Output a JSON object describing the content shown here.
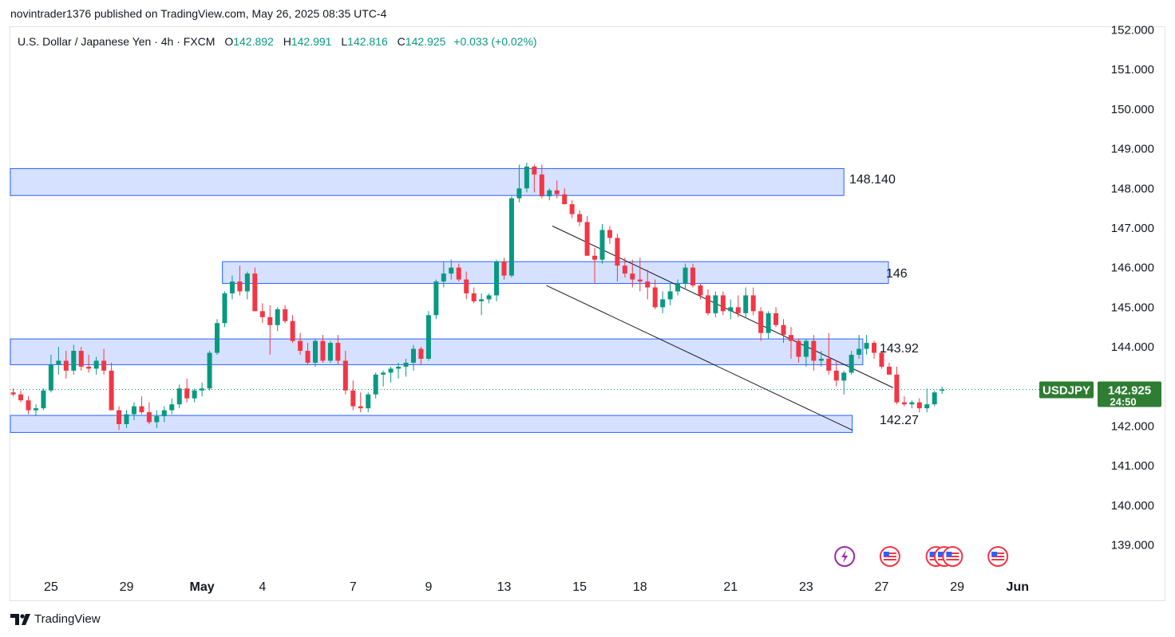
{
  "header": {
    "publisher_line": "novintrader1376 published on TradingView.com, May 26, 2025 08:35 UTC-4"
  },
  "legend": {
    "symbol_line": "U.S. Dollar / Japanese Yen · 4h · FXCM",
    "open_label": "O",
    "open": "142.892",
    "high_label": "H",
    "high": "142.991",
    "low_label": "L",
    "low": "142.816",
    "close_label": "C",
    "close": "142.925",
    "change": "+0.033 (+0.02%)"
  },
  "footer": {
    "brand": "TradingView"
  },
  "colors": {
    "up": "#089981",
    "down": "#f23645",
    "zone_fill": "#d6e1ff",
    "zone_stroke": "#2962ff",
    "price_tag": "#2e7d32",
    "event_purple": "#9c27b0",
    "event_red": "#f23645"
  },
  "icons": [
    "lightning-event-icon",
    "us-flag-event-icon"
  ],
  "price_tag": {
    "symbol": "USDJPY",
    "price": "142.925",
    "countdown": "24:50"
  },
  "chart_data": {
    "type": "candlestick",
    "symbol": "USDJPY",
    "timeframe": "4h",
    "y_axis": {
      "ylim": [
        138.7,
        152.05
      ],
      "ticks": [
        "152.000",
        "151.000",
        "150.000",
        "149.000",
        "148.000",
        "147.000",
        "146.000",
        "145.000",
        "144.000",
        "143.000",
        "142.000",
        "141.000",
        "140.000",
        "139.000"
      ]
    },
    "x_axis": {
      "ticks": [
        {
          "label": "25",
          "i": 5
        },
        {
          "label": "29",
          "i": 15
        },
        {
          "label": "May",
          "i": 25
        },
        {
          "label": "4",
          "i": 33
        },
        {
          "label": "7",
          "i": 45
        },
        {
          "label": "9",
          "i": 55
        },
        {
          "label": "13",
          "i": 65
        },
        {
          "label": "15",
          "i": 75
        },
        {
          "label": "18",
          "i": 83
        },
        {
          "label": "21",
          "i": 95
        },
        {
          "label": "23",
          "i": 105
        },
        {
          "label": "27",
          "i": 115
        },
        {
          "label": "29",
          "i": 125
        },
        {
          "label": "Jun",
          "i": 133
        }
      ]
    },
    "zones": [
      {
        "label": "148.140",
        "low": 147.82,
        "high": 148.5,
        "i_from": -1,
        "i_to": 110
      },
      {
        "label": "146",
        "low": 145.6,
        "high": 146.15,
        "i_from": 27.7,
        "i_to": 115.9
      },
      {
        "label": "143.92",
        "low": 143.55,
        "high": 144.2,
        "i_from": -1,
        "i_to": 112.5
      },
      {
        "label": "142.27",
        "low": 141.84,
        "high": 142.27,
        "i_from": -1,
        "i_to": 111.1
      }
    ],
    "channel": [
      {
        "from": {
          "i": 71.4,
          "p": 147.05
        },
        "to": {
          "i": 116.5,
          "p": 142.97
        }
      },
      {
        "from": {
          "i": 70.6,
          "p": 145.55
        },
        "to": {
          "i": 111.1,
          "p": 141.9
        }
      }
    ],
    "last_price": 142.925,
    "events": [
      {
        "kind": "lightning",
        "i": 110.1
      },
      {
        "kind": "us-flag",
        "i": 116.1
      },
      {
        "kind": "us-flag",
        "i": 122.2
      },
      {
        "kind": "us-flag",
        "i": 123.3
      },
      {
        "kind": "us-flag",
        "i": 124.4
      },
      {
        "kind": "us-flag",
        "i": 130.4
      }
    ],
    "candles": [
      [
        142.85,
        142.95,
        142.75,
        142.8
      ],
      [
        142.8,
        142.9,
        142.6,
        142.65
      ],
      [
        142.65,
        142.75,
        142.3,
        142.4
      ],
      [
        142.4,
        142.55,
        142.25,
        142.45
      ],
      [
        142.45,
        142.95,
        142.4,
        142.9
      ],
      [
        142.9,
        143.8,
        142.85,
        143.55
      ],
      [
        143.55,
        144.0,
        143.3,
        143.65
      ],
      [
        143.65,
        143.9,
        143.2,
        143.4
      ],
      [
        143.4,
        144.05,
        143.3,
        143.9
      ],
      [
        143.9,
        144.0,
        143.4,
        143.5
      ],
      [
        143.5,
        143.8,
        143.35,
        143.45
      ],
      [
        143.45,
        143.75,
        143.3,
        143.65
      ],
      [
        143.65,
        143.95,
        143.3,
        143.4
      ],
      [
        143.4,
        143.6,
        142.4,
        142.4
      ],
      [
        142.4,
        142.5,
        141.9,
        142.05
      ],
      [
        142.05,
        142.4,
        141.95,
        142.3
      ],
      [
        142.3,
        142.6,
        142.15,
        142.5
      ],
      [
        142.5,
        142.75,
        142.3,
        142.35
      ],
      [
        142.35,
        142.6,
        142.05,
        142.1
      ],
      [
        142.1,
        142.4,
        141.95,
        142.25
      ],
      [
        142.25,
        142.5,
        142.1,
        142.4
      ],
      [
        142.4,
        142.7,
        142.3,
        142.55
      ],
      [
        142.55,
        143.05,
        142.45,
        142.95
      ],
      [
        142.95,
        143.2,
        142.6,
        142.7
      ],
      [
        142.7,
        142.95,
        142.6,
        142.9
      ],
      [
        142.9,
        143.1,
        142.75,
        142.95
      ],
      [
        142.95,
        143.9,
        142.9,
        143.85
      ],
      [
        143.85,
        144.7,
        143.8,
        144.6
      ],
      [
        144.6,
        145.4,
        144.5,
        145.35
      ],
      [
        145.35,
        145.8,
        145.2,
        145.65
      ],
      [
        145.65,
        146.05,
        145.3,
        145.4
      ],
      [
        145.4,
        145.9,
        145.2,
        145.85
      ],
      [
        145.85,
        146.0,
        144.9,
        144.9
      ],
      [
        144.9,
        145.1,
        144.6,
        144.75
      ],
      [
        144.75,
        145.05,
        143.8,
        144.55
      ],
      [
        144.55,
        145.0,
        144.4,
        144.95
      ],
      [
        144.95,
        145.05,
        144.6,
        144.65
      ],
      [
        144.65,
        144.8,
        144.1,
        144.15
      ],
      [
        144.15,
        144.35,
        143.8,
        143.9
      ],
      [
        143.9,
        144.1,
        143.55,
        143.6
      ],
      [
        143.6,
        144.2,
        143.5,
        144.15
      ],
      [
        144.15,
        144.3,
        143.6,
        143.65
      ],
      [
        143.65,
        144.15,
        143.6,
        144.1
      ],
      [
        144.1,
        144.3,
        143.55,
        143.65
      ],
      [
        143.65,
        143.9,
        142.8,
        142.9
      ],
      [
        142.9,
        143.15,
        142.4,
        142.5
      ],
      [
        142.5,
        142.85,
        142.35,
        142.45
      ],
      [
        142.45,
        142.85,
        142.35,
        142.8
      ],
      [
        142.8,
        143.35,
        142.7,
        143.3
      ],
      [
        143.3,
        143.4,
        143.0,
        143.35
      ],
      [
        143.35,
        143.5,
        143.1,
        143.45
      ],
      [
        143.45,
        143.6,
        143.2,
        143.5
      ],
      [
        143.5,
        143.7,
        143.25,
        143.6
      ],
      [
        143.6,
        144.05,
        143.4,
        143.95
      ],
      [
        143.95,
        144.0,
        143.55,
        143.7
      ],
      [
        143.7,
        144.9,
        143.65,
        144.8
      ],
      [
        144.8,
        145.7,
        144.7,
        145.65
      ],
      [
        145.65,
        146.15,
        145.5,
        145.85
      ],
      [
        145.85,
        146.2,
        145.7,
        146.0
      ],
      [
        146.0,
        146.1,
        145.65,
        145.7
      ],
      [
        145.7,
        145.9,
        145.2,
        145.35
      ],
      [
        145.35,
        145.5,
        145.1,
        145.15
      ],
      [
        145.15,
        145.35,
        144.8,
        145.2
      ],
      [
        145.2,
        145.35,
        145.1,
        145.3
      ],
      [
        145.3,
        146.2,
        145.15,
        146.15
      ],
      [
        146.15,
        146.25,
        145.7,
        145.8
      ],
      [
        145.8,
        147.8,
        145.75,
        147.75
      ],
      [
        147.75,
        148.6,
        147.65,
        148.0
      ],
      [
        148.0,
        148.65,
        147.9,
        148.55
      ],
      [
        148.55,
        148.6,
        147.9,
        148.35
      ],
      [
        148.35,
        148.6,
        147.75,
        147.8
      ],
      [
        147.8,
        148.0,
        147.7,
        147.95
      ],
      [
        147.95,
        148.2,
        147.75,
        147.85
      ],
      [
        147.85,
        148.0,
        147.6,
        147.6
      ],
      [
        147.6,
        147.7,
        147.25,
        147.35
      ],
      [
        147.35,
        147.45,
        147.05,
        147.15
      ],
      [
        147.15,
        147.3,
        146.3,
        146.3
      ],
      [
        146.3,
        146.5,
        145.6,
        146.2
      ],
      [
        146.2,
        147.1,
        146.1,
        146.95
      ],
      [
        146.95,
        147.05,
        146.6,
        146.75
      ],
      [
        146.75,
        146.85,
        145.65,
        146.05
      ],
      [
        146.05,
        146.25,
        145.75,
        145.85
      ],
      [
        145.85,
        146.2,
        145.5,
        145.7
      ],
      [
        145.7,
        146.25,
        145.4,
        145.65
      ],
      [
        145.65,
        145.95,
        145.2,
        145.5
      ],
      [
        145.5,
        145.7,
        144.95,
        145.0
      ],
      [
        145.0,
        145.4,
        144.85,
        145.2
      ],
      [
        145.2,
        145.6,
        145.05,
        145.4
      ],
      [
        145.4,
        145.7,
        145.3,
        145.6
      ],
      [
        145.6,
        146.1,
        145.45,
        146.0
      ],
      [
        146.0,
        146.1,
        145.5,
        145.55
      ],
      [
        145.55,
        145.6,
        145.2,
        145.3
      ],
      [
        145.3,
        145.45,
        144.8,
        144.85
      ],
      [
        144.85,
        145.4,
        144.75,
        145.3
      ],
      [
        145.3,
        145.4,
        144.8,
        144.9
      ],
      [
        144.9,
        145.2,
        144.7,
        145.0
      ],
      [
        145.0,
        145.3,
        144.75,
        144.85
      ],
      [
        144.85,
        145.5,
        144.75,
        145.3
      ],
      [
        145.3,
        145.5,
        144.8,
        144.9
      ],
      [
        144.9,
        145.0,
        144.15,
        144.35
      ],
      [
        144.35,
        144.9,
        144.2,
        144.85
      ],
      [
        144.85,
        145.0,
        144.5,
        144.55
      ],
      [
        144.55,
        144.7,
        144.1,
        144.3
      ],
      [
        144.3,
        144.5,
        143.7,
        144.15
      ],
      [
        144.15,
        144.2,
        143.6,
        143.75
      ],
      [
        143.75,
        144.2,
        143.5,
        144.15
      ],
      [
        144.15,
        144.3,
        143.4,
        143.65
      ],
      [
        143.65,
        143.9,
        143.5,
        143.7
      ],
      [
        143.7,
        144.35,
        143.3,
        143.4
      ],
      [
        143.4,
        143.65,
        143.0,
        143.15
      ],
      [
        143.15,
        143.4,
        142.8,
        143.35
      ],
      [
        143.35,
        143.9,
        143.3,
        143.8
      ],
      [
        143.8,
        144.3,
        143.7,
        143.95
      ],
      [
        143.95,
        144.3,
        143.8,
        144.1
      ],
      [
        144.1,
        144.15,
        143.7,
        143.85
      ],
      [
        143.85,
        143.9,
        143.45,
        143.5
      ],
      [
        143.5,
        143.6,
        143.3,
        143.3
      ],
      [
        143.3,
        143.5,
        142.55,
        142.6
      ],
      [
        142.6,
        142.75,
        142.5,
        142.55
      ],
      [
        142.55,
        142.65,
        142.45,
        142.6
      ],
      [
        142.6,
        142.7,
        142.35,
        142.45
      ],
      [
        142.45,
        142.95,
        142.35,
        142.55
      ],
      [
        142.55,
        142.9,
        142.5,
        142.85
      ],
      [
        142.892,
        142.991,
        142.816,
        142.925
      ]
    ]
  }
}
